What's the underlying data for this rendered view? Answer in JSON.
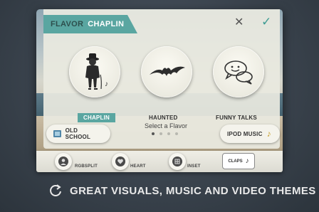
{
  "header": {
    "flavor_label": "FLAVOR",
    "current_flavor": "CHAPLIN"
  },
  "flavors": [
    {
      "label": "CHAPLIN",
      "icon": "chaplin-icon",
      "selected": true
    },
    {
      "label": "HAUNTED",
      "icon": "bat-icon",
      "selected": false
    },
    {
      "label": "FUNNY TALKS",
      "icon": "speech-bubbles-icon",
      "selected": false
    }
  ],
  "select_prompt": "Select a Flavor",
  "pager": {
    "count": 4,
    "active_index": 0
  },
  "buttons": {
    "old_school": "OLD SCHOOL",
    "ipod_music": "IPOD MUSIC"
  },
  "themes": [
    {
      "label": "RGBSPLIT",
      "icon": "person-icon"
    },
    {
      "label": "HEART",
      "icon": "heart-icon"
    },
    {
      "label": "INSET",
      "icon": "grid-icon"
    },
    {
      "label": "CLAPS",
      "icon": "music-note-icon"
    }
  ],
  "caption": "GREAT VISUALS, MUSIC AND VIDEO THEMES",
  "colors": {
    "accent": "#5aa6a1",
    "music_note": "#caa12e",
    "background": "#3a434d"
  }
}
